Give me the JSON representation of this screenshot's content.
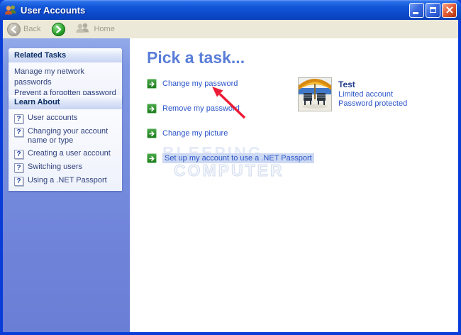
{
  "window": {
    "title": "User Accounts"
  },
  "toolbar": {
    "back_label": "Back",
    "home_label": "Home"
  },
  "sidebar": {
    "related_tasks": {
      "title": "Related Tasks",
      "links": [
        "Manage my network passwords",
        "Prevent a forgotten password"
      ]
    },
    "learn_about": {
      "title": "Learn About",
      "links": [
        "User accounts",
        "Changing your account name or type",
        "Creating a user account",
        "Switching users",
        "Using a .NET Passport"
      ]
    }
  },
  "main": {
    "heading": "Pick a task...",
    "tasks": [
      "Change my password",
      "Remove my password",
      "Change my picture",
      "Set up my account to use a .NET Passport"
    ],
    "account": {
      "name": "Test",
      "type": "Limited account",
      "status": "Password protected"
    }
  },
  "watermark": {
    "line1": "BLEEPING",
    "line2": "COMPUTER"
  },
  "icons": {
    "help_glyph": "?"
  },
  "colors": {
    "titlebar_blue": "#1256d8",
    "window_border": "#0a3cd8",
    "toolbar_beige": "#ece9d8",
    "sidebar_blue": "#7e97e2",
    "sidebar_link": "#31427e",
    "task_link": "#2b55c8",
    "heading_blue": "#5a7ed8",
    "task_icon_green": "#1e7c1e",
    "forward_green": "#2ba02b",
    "close_red": "#e25a34",
    "annotation_red": "#ed1c36",
    "highlight_blue": "#cdd9f3"
  }
}
